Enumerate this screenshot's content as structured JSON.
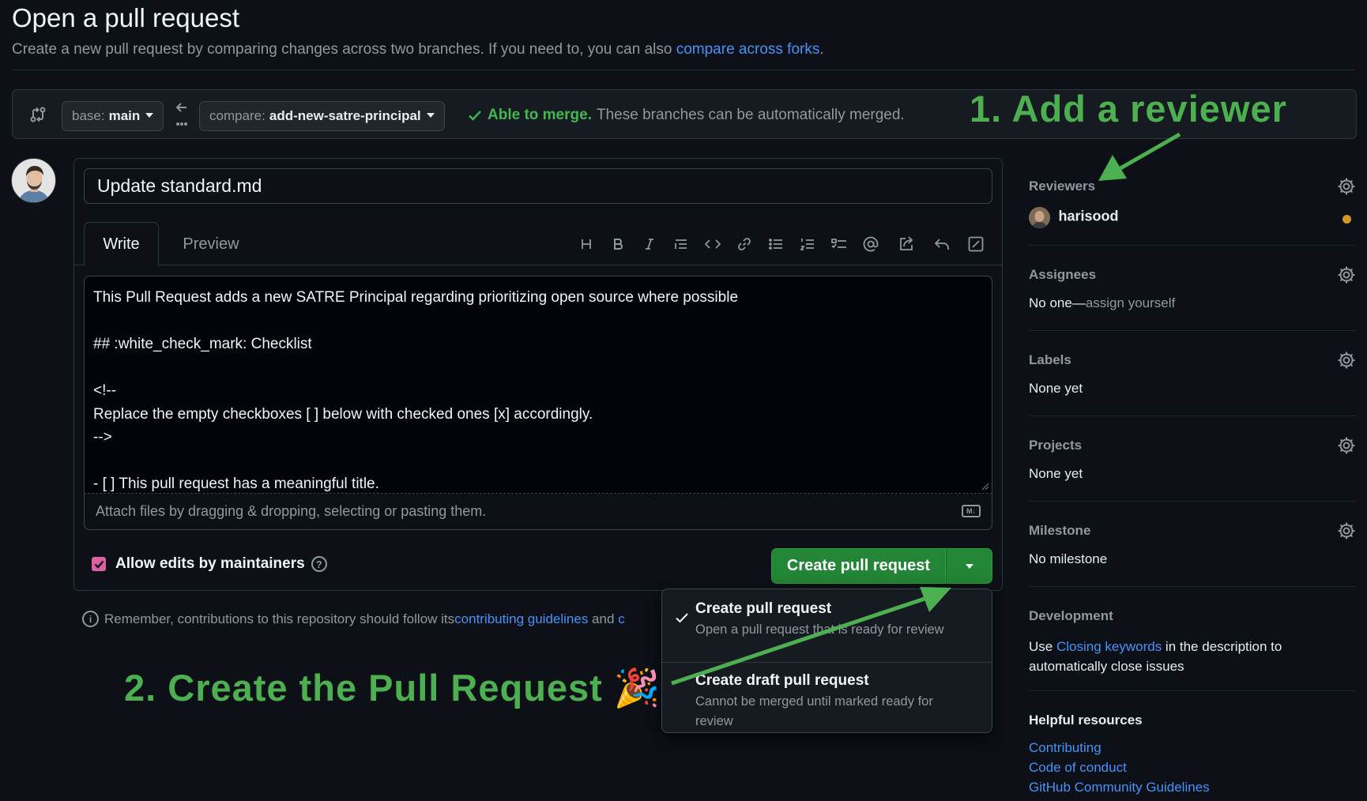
{
  "header": {
    "title": "Open a pull request",
    "subtitle": "Create a new pull request by comparing changes across two branches. If you need to, you can also ",
    "subtitle_link": "compare across forks",
    "subtitle_end": "."
  },
  "compare": {
    "base_prefix": "base:",
    "base_branch": "main",
    "compare_prefix": "compare:",
    "compare_branch": "add-new-satre-principal",
    "merge_ok": "Able to merge.",
    "merge_desc": "These branches can be automatically merged."
  },
  "annotations": {
    "step1": "1. Add a reviewer",
    "step2": "2. Create the Pull Request 🎉"
  },
  "form": {
    "title_value": "Update standard.md",
    "tabs": [
      "Write",
      "Preview"
    ],
    "body_lines": [
      "This Pull Request adds a new SATRE Principal regarding prioritizing open source where possible",
      "",
      "## :white_check_mark: Checklist",
      "",
      "<!--",
      "Replace the empty checkboxes [ ] below with checked ones [x] accordingly.",
      "-->",
      "",
      "- [ ] This pull request has a meaningful title."
    ],
    "attach_hint": "Attach files by dragging & dropping, selecting or pasting them.",
    "md_badge": "M↓",
    "allow_edits_label": "Allow edits by maintainers",
    "allow_edits_checked": true,
    "create_button": "Create pull request"
  },
  "contrib_note": {
    "text": "Remember, contributions to this repository should follow its ",
    "link": "contributing guidelines",
    "and": " and ",
    "trailing": "c"
  },
  "pr_menu": {
    "items": [
      {
        "title": "Create pull request",
        "desc": "Open a pull request that is ready for review",
        "selected": true
      },
      {
        "title": "Create draft pull request",
        "desc": "Cannot be merged until marked ready for review",
        "selected": false
      }
    ]
  },
  "sidebar": {
    "reviewers": {
      "label": "Reviewers",
      "user": "harisood"
    },
    "assignees": {
      "label": "Assignees",
      "value_prefix": "No one—",
      "value_link": "assign yourself"
    },
    "labels": {
      "label": "Labels",
      "value": "None yet"
    },
    "projects": {
      "label": "Projects",
      "value": "None yet"
    },
    "milestone": {
      "label": "Milestone",
      "value": "No milestone"
    },
    "development": {
      "label": "Development",
      "text_before": "Use ",
      "link": "Closing keywords",
      "text_after": " in the description to",
      "text_line2": "automatically close issues"
    },
    "resources": {
      "label": "Helpful resources",
      "links": [
        "Contributing",
        "Code of conduct",
        "GitHub Community Guidelines"
      ]
    }
  },
  "colors": {
    "background": "#0d1117",
    "accent_link": "#4493f8",
    "success": "#3fb950",
    "primary_button": "#238636",
    "annotation": "#4caf50",
    "checkbox": "#db61a2"
  }
}
